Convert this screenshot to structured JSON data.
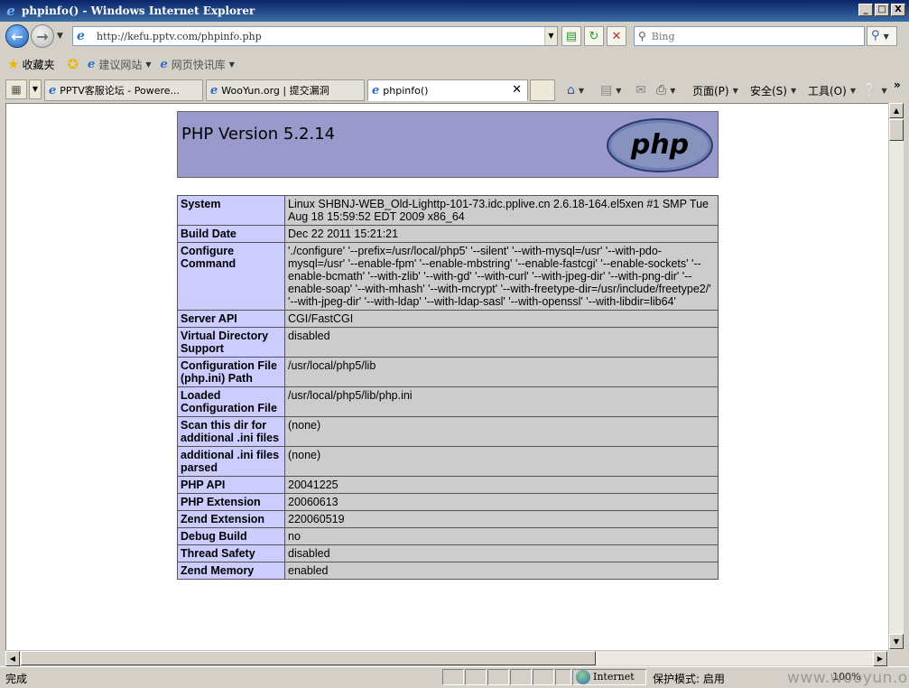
{
  "window": {
    "title": "phpinfo() - Windows Internet Explorer",
    "buttons": [
      "_",
      "□",
      "X"
    ]
  },
  "address_bar": {
    "url": "http://kefu.pptv.com/phpinfo.php",
    "search_placeholder": "Bing"
  },
  "favorites_bar": {
    "favorites_label": "收藏夹",
    "items": [
      {
        "label": "建议网站"
      },
      {
        "label": "网页快讯库"
      }
    ]
  },
  "tabs": [
    {
      "label": "PPTV客服论坛 - Powere..."
    },
    {
      "label": "WooYun.org | 提交漏洞"
    },
    {
      "label": "phpinfo()"
    }
  ],
  "command_bar": {
    "page_label": "页面(P)",
    "safety_label": "安全(S)",
    "tools_label": "工具(O)",
    "chevron": "»"
  },
  "php": {
    "version_title": "PHP Version 5.2.14",
    "logo_text": "php",
    "rows": [
      {
        "key": "System",
        "value": "Linux SHBNJ-WEB_Old-Lighttp-101-73.idc.pplive.cn 2.6.18-164.el5xen #1 SMP Tue Aug 18 15:59:52 EDT 2009 x86_64"
      },
      {
        "key": "Build Date",
        "value": "Dec 22 2011 15:21:21"
      },
      {
        "key": "Configure Command",
        "value": "'./configure' '--prefix=/usr/local/php5' '--silent' '--with-mysql=/usr' '--with-pdo-mysql=/usr' '--enable-fpm' '--enable-mbstring' '--enable-fastcgi' '--enable-sockets' '--enable-bcmath' '--with-zlib' '--with-gd' '--with-curl' '--with-jpeg-dir' '--with-png-dir' '--enable-soap' '--with-mhash' '--with-mcrypt' '--with-freetype-dir=/usr/include/freetype2/' '--with-jpeg-dir' '--with-ldap' '--with-ldap-sasl' '--with-openssl' '--with-libdir=lib64'"
      },
      {
        "key": "Server API",
        "value": "CGI/FastCGI"
      },
      {
        "key": "Virtual Directory Support",
        "value": "disabled"
      },
      {
        "key": "Configuration File (php.ini) Path",
        "value": "/usr/local/php5/lib"
      },
      {
        "key": "Loaded Configuration File",
        "value": "/usr/local/php5/lib/php.ini"
      },
      {
        "key": "Scan this dir for additional .ini files",
        "value": "(none)"
      },
      {
        "key": "additional .ini files parsed",
        "value": "(none)"
      },
      {
        "key": "PHP API",
        "value": "20041225"
      },
      {
        "key": "PHP Extension",
        "value": "20060613"
      },
      {
        "key": "Zend Extension",
        "value": "220060519"
      },
      {
        "key": "Debug Build",
        "value": "no"
      },
      {
        "key": "Thread Safety",
        "value": "disabled"
      },
      {
        "key": "Zend Memory",
        "value": "enabled"
      }
    ]
  },
  "status_bar": {
    "status": "完成",
    "zone": "Internet",
    "protected_mode": "保护模式: 启用",
    "zoom": "100%"
  },
  "watermark": "www.wooyun.org",
  "colors": {
    "php_header": "#9999cc",
    "key_cell": "#ccccff",
    "value_cell": "#cccccc",
    "titlebar": "#0a246a"
  },
  "icons": [
    "ie-icon",
    "back-icon",
    "forward-icon",
    "compatibility-icon",
    "refresh-icon",
    "stop-icon",
    "search-icon",
    "star-icon",
    "add-favorite-icon",
    "home-icon",
    "feeds-icon",
    "mail-icon",
    "print-icon",
    "help-icon",
    "globe-icon"
  ]
}
